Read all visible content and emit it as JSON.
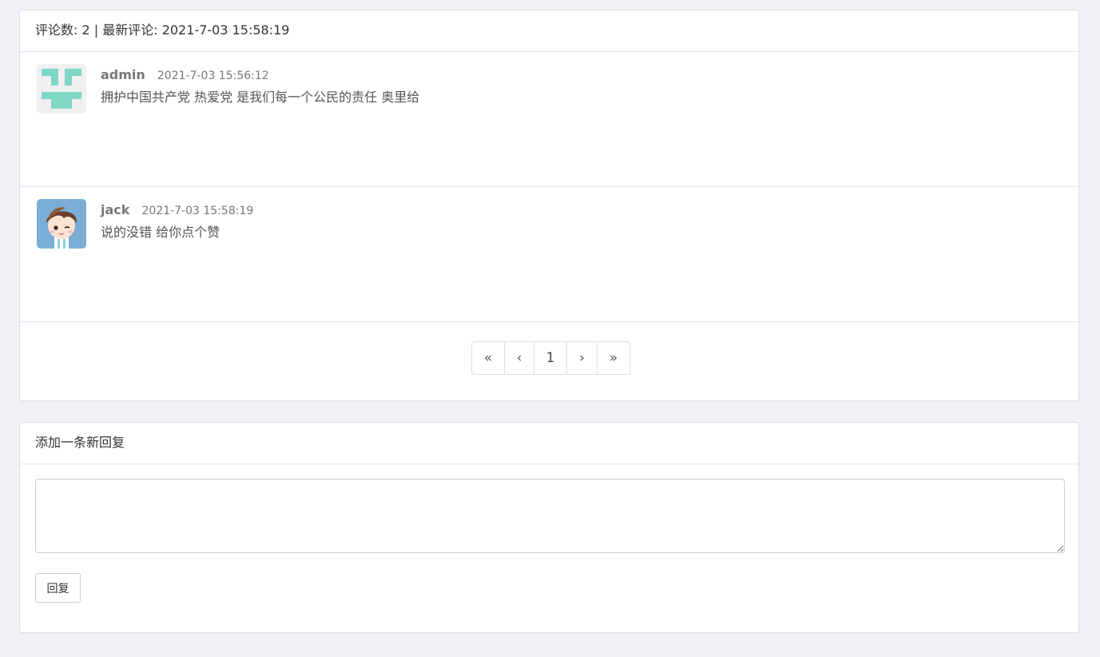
{
  "comments_panel": {
    "header": "评论数: 2 | 最新评论: 2021-7-03 15:58:19",
    "comments": [
      {
        "author": "admin",
        "time": "2021-7-03 15:56:12",
        "text": "拥护中国共产党 热爱党 是我们每一个公民的责任 奥里给",
        "avatar": "identicon-avatar"
      },
      {
        "author": "jack",
        "time": "2021-7-03 15:58:19",
        "text": "说的没错 给你点个赞",
        "avatar": "cartoon-boy-avatar"
      }
    ],
    "pagination": {
      "first": "«",
      "prev": "‹",
      "current": "1",
      "next": "›",
      "last": "»"
    }
  },
  "reply_panel": {
    "header": "添加一条新回复",
    "textarea_value": "",
    "button_label": "回复"
  },
  "colors": {
    "background": "#eff1f5",
    "identicon": "#7fd7c4",
    "identicon_bg": "#f0f0f0",
    "avatar2_bg": "#7aaed6"
  }
}
